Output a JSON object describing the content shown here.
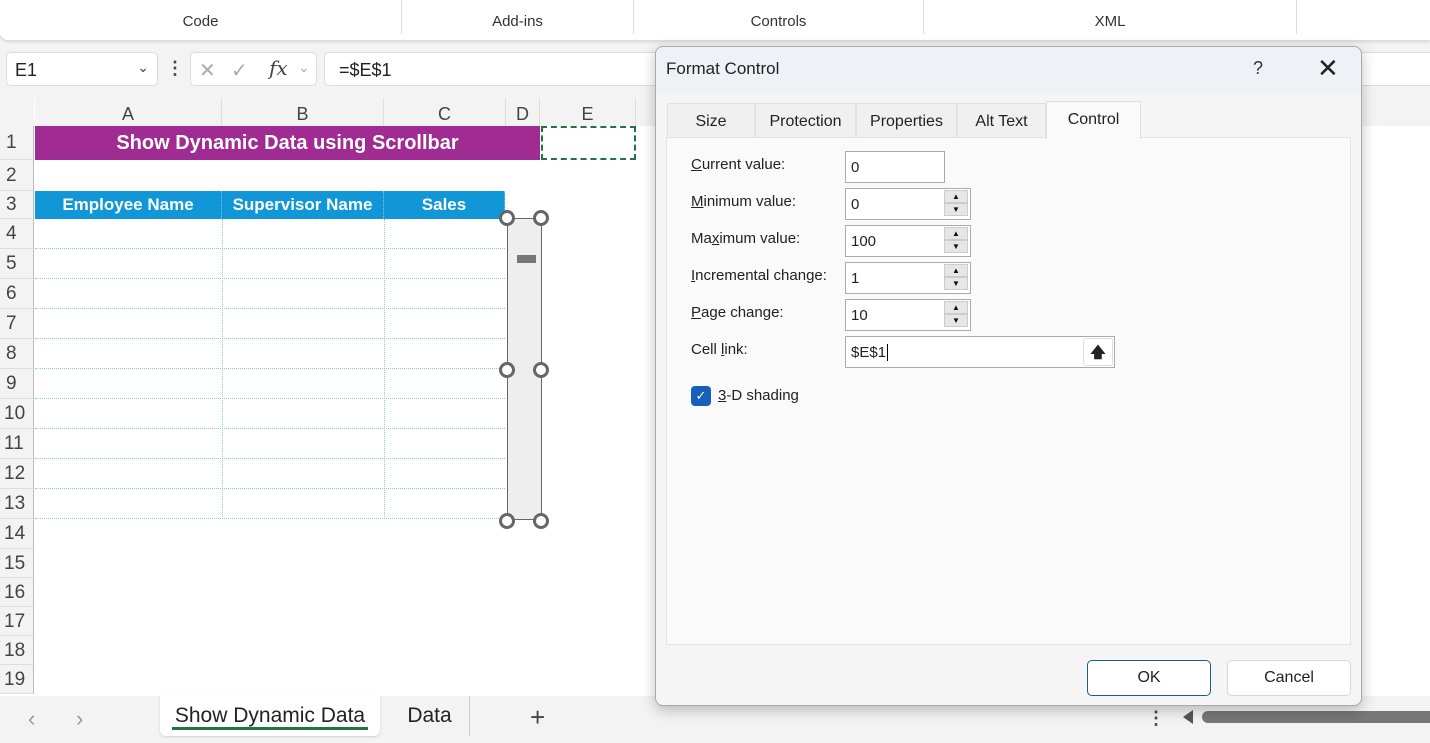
{
  "ribbon": {
    "groups": [
      "Code",
      "Add-ins",
      "Controls",
      "XML"
    ]
  },
  "formula_bar": {
    "name_box": "E1",
    "formula": "=$E$1",
    "cancel_icon": "x-icon",
    "enter_icon": "check-icon",
    "function_icon": "fx"
  },
  "sheet": {
    "columns": [
      "A",
      "B",
      "C",
      "D",
      "E"
    ],
    "rows": [
      "1",
      "2",
      "3",
      "4",
      "5",
      "6",
      "7",
      "8",
      "9",
      "10",
      "11",
      "12",
      "13",
      "14",
      "15",
      "16",
      "17",
      "18",
      "19"
    ],
    "title": "Show Dynamic Data using Scrollbar",
    "table_headers": [
      "Employee Name",
      "Supervisor Name",
      "Sales"
    ],
    "accent_colors": {
      "title_bg": "#a02b93",
      "header_bg": "#1197d8",
      "selection": "#217346"
    }
  },
  "tabs": {
    "sheets": [
      "Show Dynamic Data",
      "Data"
    ],
    "active": "Show Dynamic Data",
    "add_label": "+",
    "prev_icon": "‹",
    "next_icon": "›"
  },
  "dialog": {
    "title": "Format Control",
    "help": "?",
    "close": "✕",
    "tabs": [
      "Size",
      "Protection",
      "Properties",
      "Alt Text",
      "Control"
    ],
    "active_tab": "Control",
    "fields": {
      "current_value": {
        "label_pre": "",
        "label_key": "C",
        "label_post": "urrent value:",
        "value": "0"
      },
      "minimum_value": {
        "label_pre": "",
        "label_key": "M",
        "label_post": "inimum value:",
        "value": "0"
      },
      "maximum_value": {
        "label_pre": "Ma",
        "label_key": "x",
        "label_post": "imum value:",
        "value": "100"
      },
      "incremental_change": {
        "label_pre": "",
        "label_key": "I",
        "label_post": "ncremental change:",
        "value": "1"
      },
      "page_change": {
        "label_pre": "",
        "label_key": "P",
        "label_post": "age change:",
        "value": "10"
      },
      "cell_link": {
        "label_pre": "Cell ",
        "label_key": "l",
        "label_post": "ink:",
        "value": "$E$1"
      }
    },
    "shading": {
      "label_key": "3",
      "label_post": "-D shading",
      "checked": true
    },
    "ok_label": "OK",
    "cancel_label": "Cancel"
  }
}
